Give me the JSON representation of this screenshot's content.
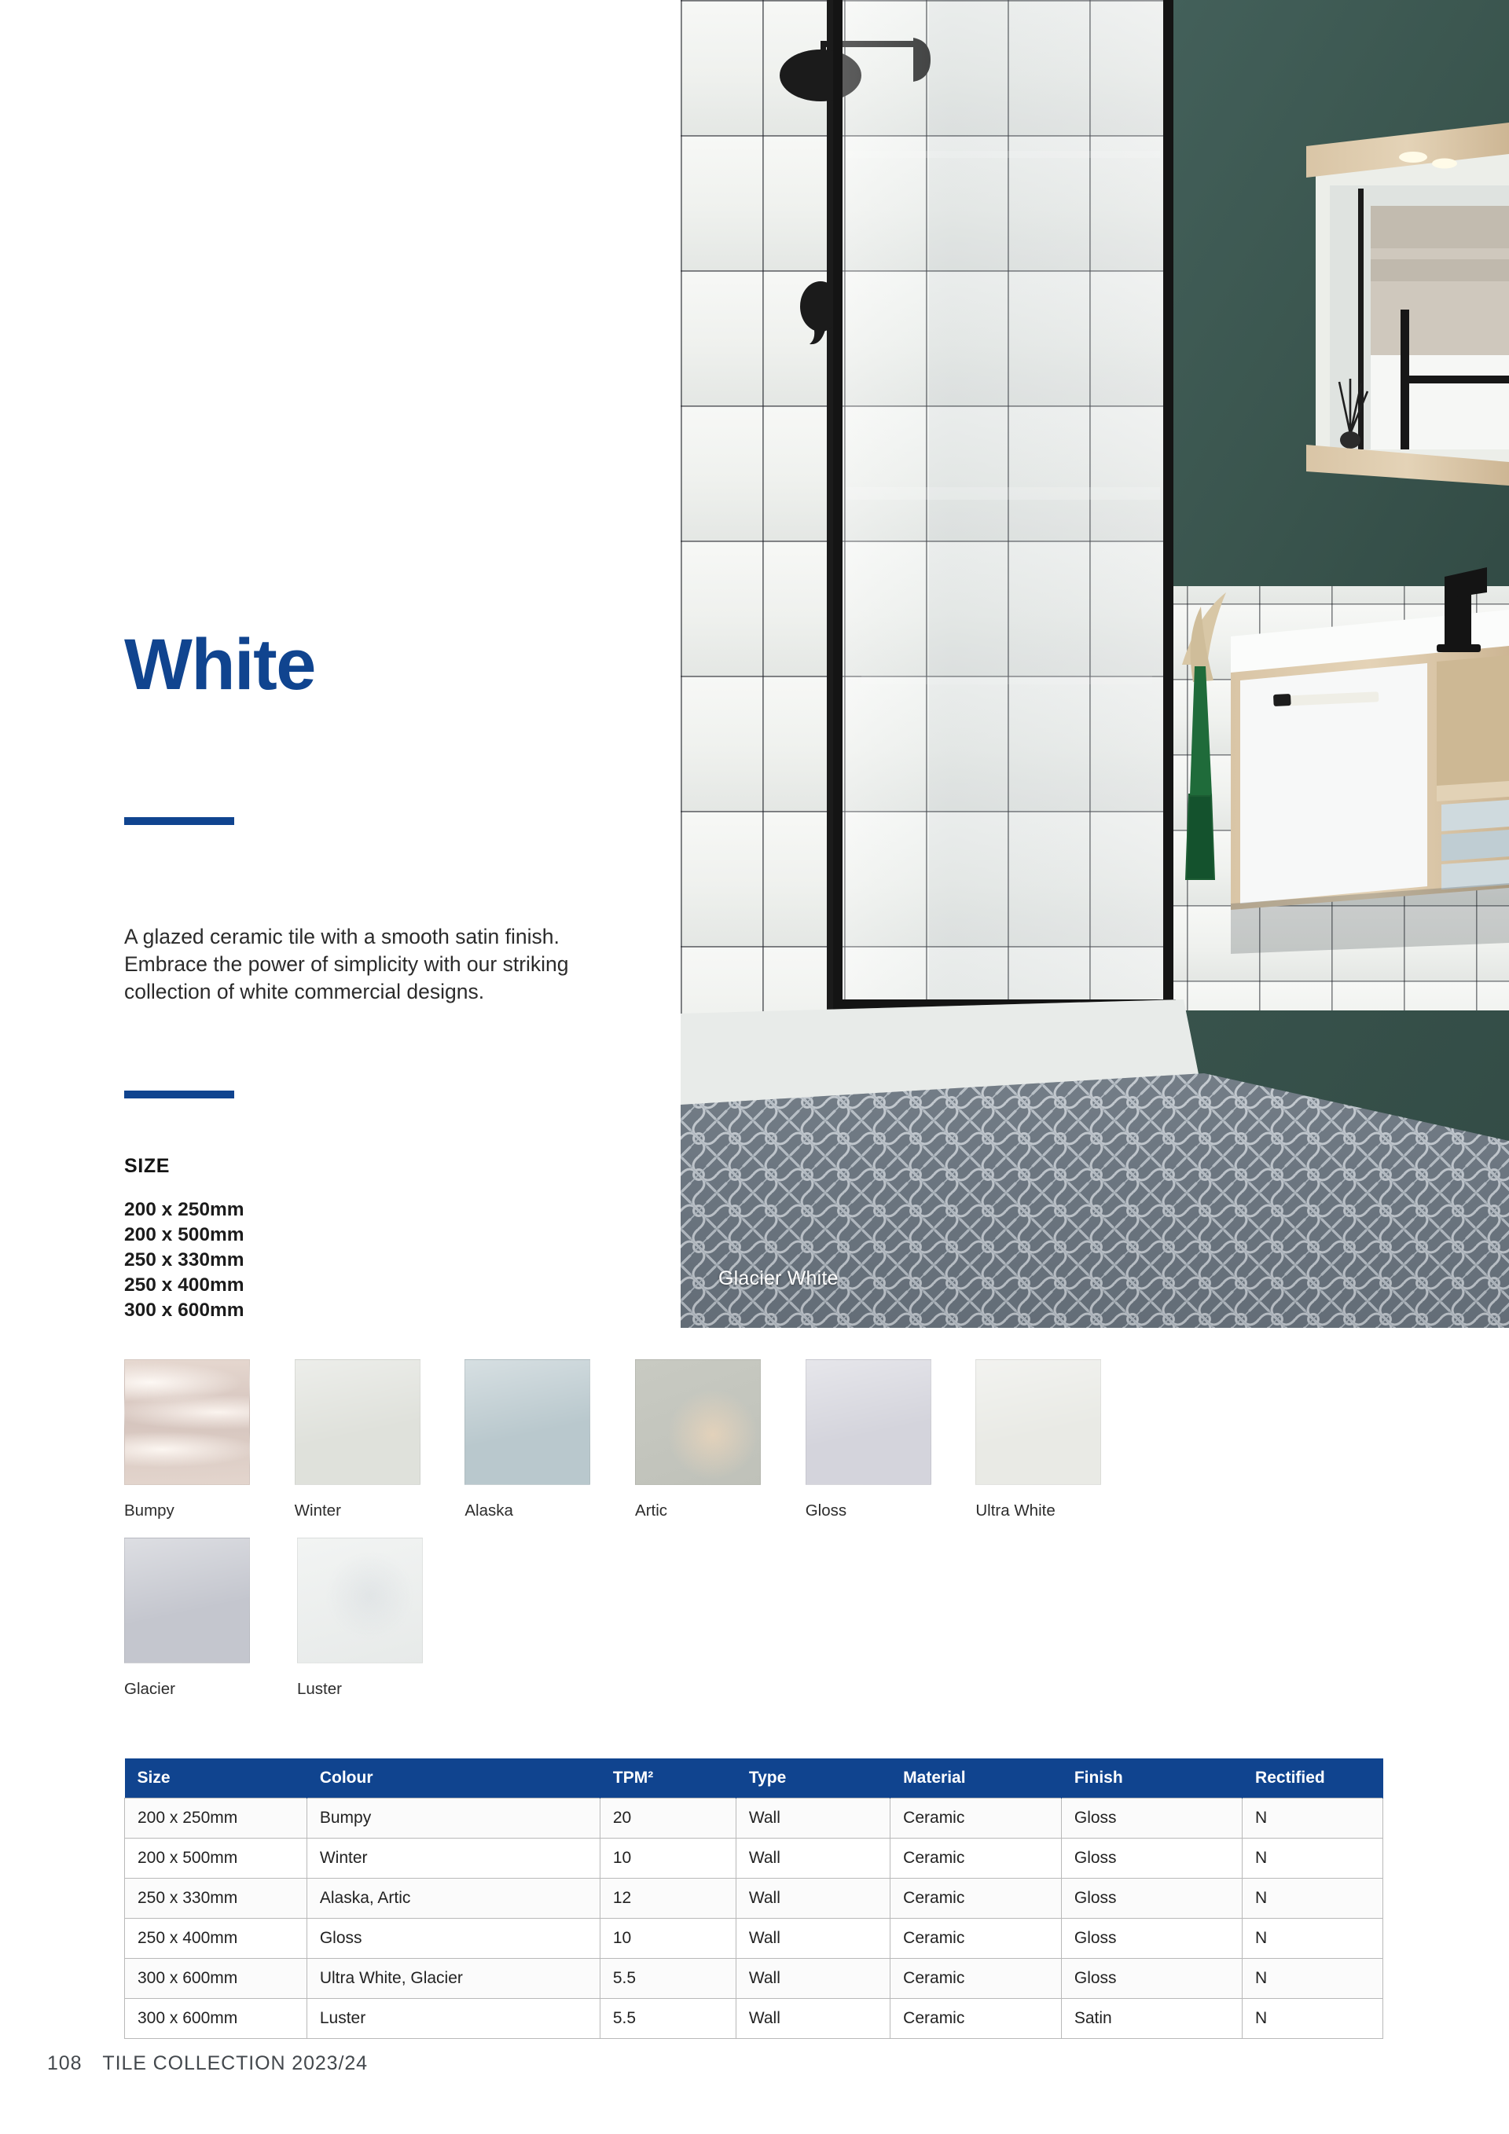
{
  "page": {
    "title": "White",
    "description": "A glazed ceramic tile with a smooth satin finish. Embrace the power of simplicity with our striking collection of white commercial designs.",
    "accent_color": "#10448f"
  },
  "hero": {
    "caption": "Glacier White",
    "wall_color": "#3c574f",
    "tile_color": "#f2f3f1",
    "fixture_color": "#1c1c1c",
    "floor_pattern_color": "#5b646e"
  },
  "size_section": {
    "heading": "SIZE",
    "sizes": [
      "200 x 250mm",
      "200 x 500mm",
      "250 x 330mm",
      "250 x 400mm",
      "300 x 600mm"
    ]
  },
  "swatches": [
    {
      "label": "Bumpy",
      "color": "#ded2cb"
    },
    {
      "label": "Winter",
      "color": "#dfe1db"
    },
    {
      "label": "Alaska",
      "color": "#b9c8cd"
    },
    {
      "label": "Artic",
      "color": "#c3c5bd"
    },
    {
      "label": "Gloss",
      "color": "#d4d4dc"
    },
    {
      "label": "Ultra White",
      "color": "#e9eae5"
    },
    {
      "label": "Glacier",
      "color": "#c4c6ce"
    },
    {
      "label": "Luster",
      "color": "#eef0ef"
    }
  ],
  "spec_table": {
    "headers": [
      "Size",
      "Colour",
      "TPM²",
      "Type",
      "Material",
      "Finish",
      "Rectified"
    ],
    "rows": [
      [
        "200 x 250mm",
        "Bumpy",
        "20",
        "Wall",
        "Ceramic",
        "Gloss",
        "N"
      ],
      [
        "200 x 500mm",
        "Winter",
        "10",
        "Wall",
        "Ceramic",
        "Gloss",
        "N"
      ],
      [
        "250 x 330mm",
        "Alaska, Artic",
        "12",
        "Wall",
        "Ceramic",
        "Gloss",
        "N"
      ],
      [
        "250 x 400mm",
        "Gloss",
        "10",
        "Wall",
        "Ceramic",
        "Gloss",
        "N"
      ],
      [
        "300 x 600mm",
        "Ultra White, Glacier",
        "5.5",
        "Wall",
        "Ceramic",
        "Gloss",
        "N"
      ],
      [
        "300 x 600mm",
        "Luster",
        "5.5",
        "Wall",
        "Ceramic",
        "Satin",
        "N"
      ]
    ]
  },
  "footer": {
    "page_number": "108",
    "publication": "TILE COLLECTION 2023/24"
  }
}
